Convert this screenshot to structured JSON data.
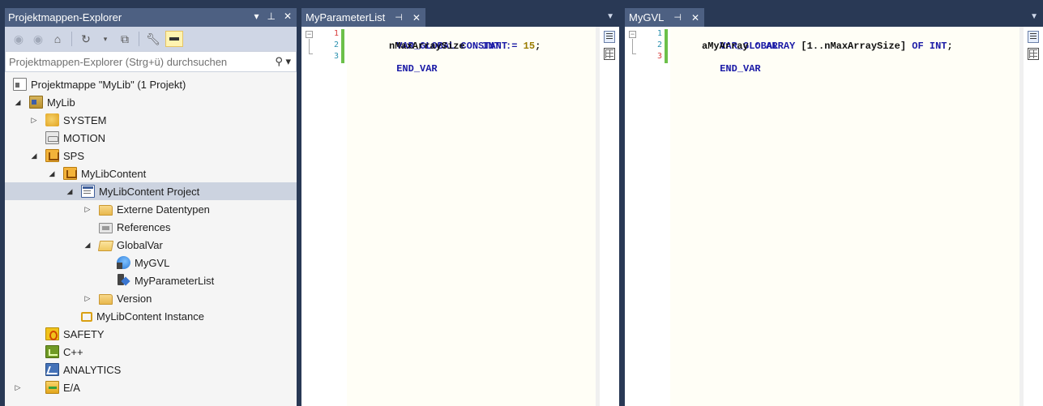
{
  "explorer": {
    "title": "Projektmappen-Explorer",
    "title_actions": [
      "▾",
      "ᵖ",
      "✕"
    ],
    "search_placeholder": "Projektmappen-Explorer (Strg+ü) durchsuchen",
    "tree": [
      {
        "label": "Projektmappe \"MyLib\" (1 Projekt)",
        "icon": "solution-icon"
      },
      {
        "label": "MyLib",
        "icon": "library-project-icon"
      },
      {
        "label": "SYSTEM",
        "icon": "system-icon"
      },
      {
        "label": "MOTION",
        "icon": "motion-icon"
      },
      {
        "label": "SPS",
        "icon": "sps-icon"
      },
      {
        "label": "MyLibContent",
        "icon": "plc-project-icon"
      },
      {
        "label": "MyLibContent Project",
        "icon": "plc-project-file-icon"
      },
      {
        "label": "Externe Datentypen",
        "icon": "folder-icon"
      },
      {
        "label": "References",
        "icon": "references-icon"
      },
      {
        "label": "GlobalVar",
        "icon": "folder-open-icon"
      },
      {
        "label": "MyGVL",
        "icon": "gvl-icon"
      },
      {
        "label": "MyParameterList",
        "icon": "parameter-list-icon"
      },
      {
        "label": "Version",
        "icon": "folder-icon"
      },
      {
        "label": "MyLibContent Instance",
        "icon": "instance-icon"
      },
      {
        "label": "SAFETY",
        "icon": "safety-icon"
      },
      {
        "label": "C++",
        "icon": "cpp-icon"
      },
      {
        "label": "ANALYTICS",
        "icon": "analytics-icon"
      },
      {
        "label": "E/A",
        "icon": "io-icon"
      }
    ]
  },
  "editor1": {
    "tab_label": "MyParameterList",
    "lines": [
      {
        "num": "1"
      },
      {
        "num": "2"
      },
      {
        "num": "3"
      }
    ],
    "code": {
      "l1_kw": "VAR_GLOBAL CONSTANT",
      "l2_ident": "nMaxArraySize",
      "l2_colon": " : ",
      "l2_type": "INT",
      "l2_assign": " := ",
      "l2_value": "15",
      "l2_semi": ";",
      "l3_kw": "END_VAR"
    }
  },
  "editor2": {
    "tab_label": "MyGVL",
    "lines": [
      {
        "num": "1"
      },
      {
        "num": "2"
      },
      {
        "num": "3"
      }
    ],
    "code": {
      "l1_kw": "VAR_GLOBAL",
      "l2_ident": "aMyArray",
      "l2_colon": " : ",
      "l2_array": "ARRAY",
      "l2_range": " [1..nMaxArraySize] ",
      "l2_of": "OF",
      "l2_type": " INT",
      "l2_semi": ";",
      "l3_kw": "END_VAR"
    }
  },
  "colors": {
    "background": "#293955",
    "title_bar": "#4d6082",
    "keyword": "#1a1aa6",
    "number": "#9a7c00",
    "line_number": "#2b91af",
    "changed_line_marker": "#6cc04a"
  }
}
